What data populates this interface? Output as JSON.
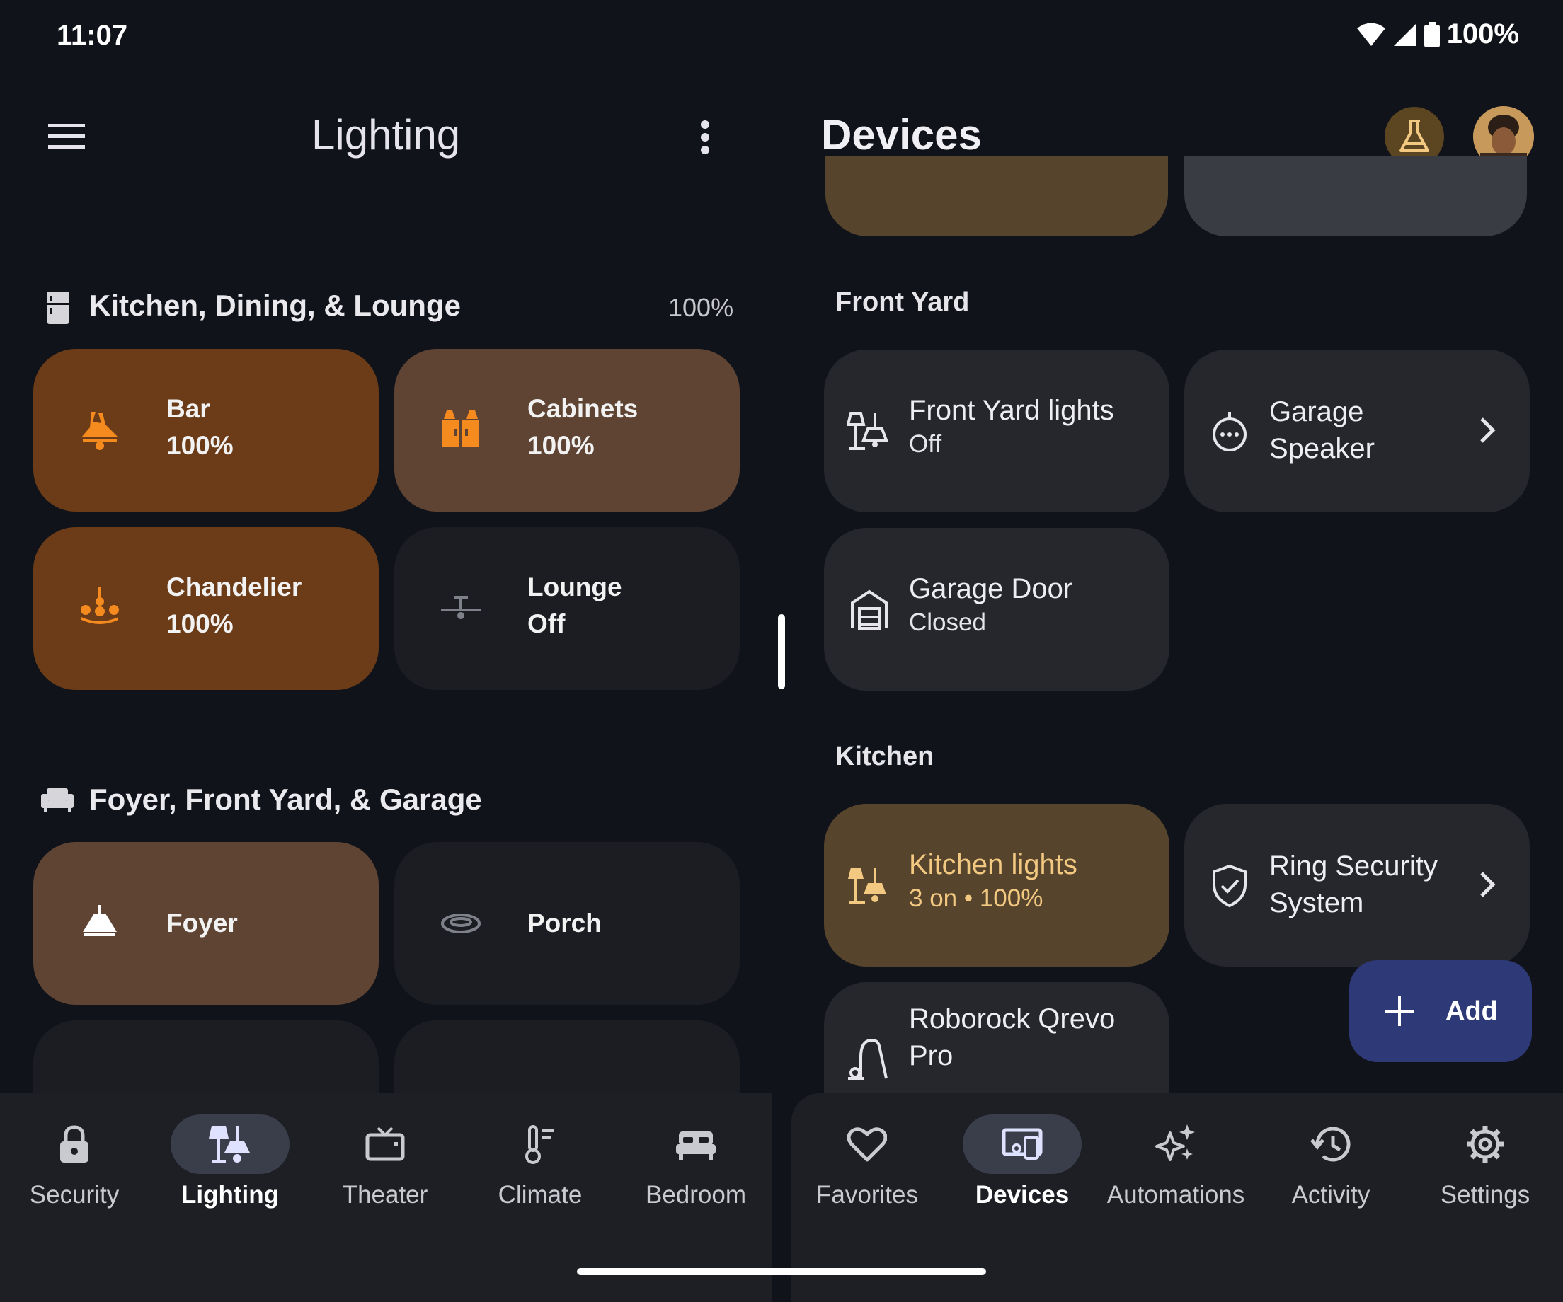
{
  "status_bar": {
    "time": "11:07",
    "battery": "100%"
  },
  "lighting_panel": {
    "title": "Lighting",
    "rooms": [
      {
        "name": "Kitchen, Dining, & Lounge",
        "percent": "100%",
        "tiles": [
          {
            "name": "Bar",
            "value": "100%"
          },
          {
            "name": "Cabinets",
            "value": "100%"
          },
          {
            "name": "Chandelier",
            "value": "100%"
          },
          {
            "name": "Lounge",
            "value": "Off"
          }
        ]
      },
      {
        "name": "Foyer, Front Yard, & Garage",
        "tiles": [
          {
            "name": "Foyer"
          },
          {
            "name": "Porch"
          }
        ]
      }
    ]
  },
  "devices_panel": {
    "title": "Devices",
    "sections": [
      {
        "name": "Front Yard",
        "devices": [
          {
            "name": "Front Yard lights",
            "value": "Off"
          },
          {
            "name": "Garage Speaker"
          },
          {
            "name": "Garage Door",
            "value": "Closed"
          }
        ]
      },
      {
        "name": "Kitchen",
        "devices": [
          {
            "name": "Kitchen lights",
            "value": "3 on • 100%"
          },
          {
            "name": "Ring Security System"
          },
          {
            "name": "Roborock Qrevo Pro"
          }
        ]
      }
    ],
    "fab_label": "Add"
  },
  "left_nav": [
    {
      "label": "Security",
      "icon": "lock-icon"
    },
    {
      "label": "Lighting",
      "icon": "lamp-icon",
      "active": true
    },
    {
      "label": "Theater",
      "icon": "tv-icon"
    },
    {
      "label": "Climate",
      "icon": "thermometer-icon"
    },
    {
      "label": "Bedroom",
      "icon": "bed-icon"
    }
  ],
  "right_nav": [
    {
      "label": "Favorites",
      "icon": "heart-icon"
    },
    {
      "label": "Devices",
      "icon": "devices-icon",
      "active": true
    },
    {
      "label": "Automations",
      "icon": "sparkle-icon"
    },
    {
      "label": "Activity",
      "icon": "history-icon"
    },
    {
      "label": "Settings",
      "icon": "gear-icon"
    }
  ],
  "colors": {
    "background": "#11131a",
    "tile_orange": "#6b3c17",
    "tile_brown": "#5f4434",
    "device_tile": "#25272d",
    "kitchen_lights_tile": "#56452c",
    "accent_orange": "#f58a1f",
    "accent_gold": "#f3c982",
    "fab": "#2e3a78"
  }
}
